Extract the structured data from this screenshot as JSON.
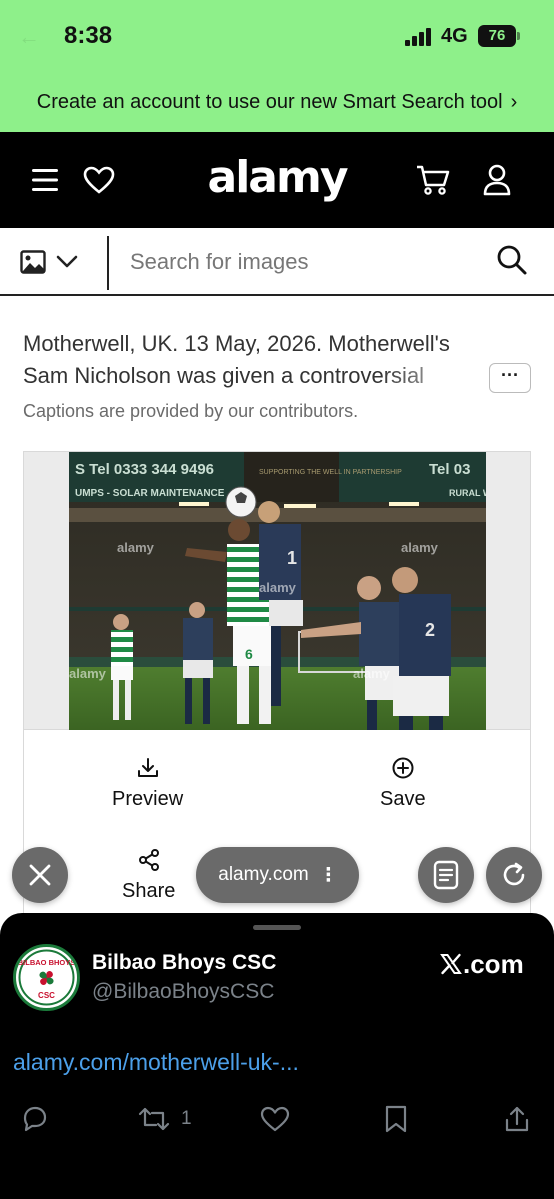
{
  "status_bar": {
    "time": "8:38",
    "network": "4G",
    "battery": "76"
  },
  "banner": {
    "text": "Create an account to use our new Smart Search tool",
    "chevron": "›"
  },
  "header": {
    "logo": "alamy",
    "menu_icon": "hamburger-icon",
    "wishlist_icon": "heart-icon",
    "cart_icon": "cart-icon",
    "account_icon": "user-icon"
  },
  "search": {
    "placeholder": "Search for images",
    "type_icon": "image-icon",
    "type_chevron": "chevron-down-icon",
    "submit_icon": "search-icon"
  },
  "caption": {
    "text": "Motherwell, UK. 13 May, 2026. Motherwell's Sam Nicholson was given a controversial",
    "more_label": "···",
    "note": "Captions are provided by our contributors."
  },
  "image": {
    "watermark": "alamy",
    "ad_board_left": "S  Tel 0333 344 9496",
    "ad_board_left2": "UMPS - SOLAR MAINTENANCE",
    "ad_board_mid": "SUPPORTING THE WELL IN PARTNERSHIP",
    "ad_board_right": "Tel 03",
    "ad_board_right2": "RURAL W",
    "player_number_1": "6",
    "player_number_2": "1",
    "player_number_3": "2"
  },
  "actions": {
    "preview_label": "Preview",
    "save_label": "Save",
    "share_label": "Share"
  },
  "browser": {
    "url": "alamy.com",
    "url_menu": "⋮"
  },
  "tweet": {
    "name": "Bilbao Bhoys CSC",
    "handle": "@BilbaoBhoysCSC",
    "source": ".com",
    "link": "alamy.com/motherwell-uk-...",
    "retweet_count": "1",
    "avatar_top": "BILBAO BHOYS",
    "avatar_bottom": "CSC"
  },
  "colors": {
    "banner_bg": "#8ef08a",
    "header_bg": "#000000",
    "link": "#4ca0ea",
    "tweet_bg": "#000000"
  }
}
